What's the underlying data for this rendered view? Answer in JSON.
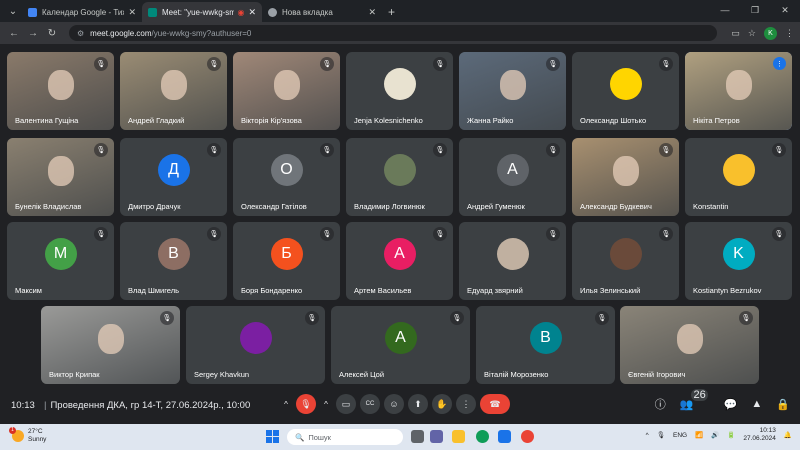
{
  "browser": {
    "tabs": [
      {
        "title": "Календар Google - Тиждень ...",
        "favicon_color": "#4285f4",
        "active": false
      },
      {
        "title": "Meet: \"yue-wwkg-smy\"",
        "favicon_color": "#00897b",
        "active": true
      },
      {
        "title": "Нова вкладка",
        "favicon_color": "#9aa0a6",
        "active": false
      }
    ],
    "url_host": "meet.google.com",
    "url_path": "/yue-wwkg-smy?authuser=0",
    "profile_initial": "K"
  },
  "participants": [
    {
      "name": "Валентина Гущіна",
      "type": "photo",
      "color": "#8a7a6a"
    },
    {
      "name": "Андрей Гладкий",
      "type": "photo",
      "color": "#9a8c74"
    },
    {
      "name": "Вікторія Кір'язова",
      "type": "photo",
      "color": "#a08878"
    },
    {
      "name": "Jenja Kolesnichenko",
      "type": "avatar",
      "initial": "",
      "color": "#e8e2d0"
    },
    {
      "name": "Жанна Райко",
      "type": "photo",
      "color": "#5c6a7a"
    },
    {
      "name": "Олександр Шотько",
      "type": "avatar",
      "initial": "",
      "color": "#ffd500"
    },
    {
      "name": "Нікіта Петров",
      "type": "photo",
      "color": "#b0a080"
    },
    {
      "name": "Бунелік Владислав",
      "type": "photo",
      "color": "#8a8070"
    },
    {
      "name": "Дмитро Драчук",
      "type": "avatar",
      "initial": "Д",
      "color": "#1a73e8"
    },
    {
      "name": "Олександр Гатілов",
      "type": "avatar",
      "initial": "О",
      "color": "#70757a"
    },
    {
      "name": "Владимир Логвинюк",
      "type": "avatar",
      "initial": "",
      "color": "#6a7a5a"
    },
    {
      "name": "Андрей Гуменюк",
      "type": "avatar",
      "initial": "А",
      "color": "#5f6368"
    },
    {
      "name": "Александр Будкевич",
      "type": "photo",
      "color": "#a89070"
    },
    {
      "name": "Konstantin",
      "type": "avatar",
      "initial": "",
      "color": "#f9c02c"
    },
    {
      "name": "Максим",
      "type": "avatar",
      "initial": "М",
      "color": "#43a047"
    },
    {
      "name": "Влад Шмигель",
      "type": "avatar",
      "initial": "В",
      "color": "#8d6e63"
    },
    {
      "name": "Боря Бондаренко",
      "type": "avatar",
      "initial": "Б",
      "color": "#f4511e"
    },
    {
      "name": "Артем Васильев",
      "type": "avatar",
      "initial": "А",
      "color": "#e91e63"
    },
    {
      "name": "Едуард звярний",
      "type": "avatar",
      "initial": "",
      "color": "#c0b0a0"
    },
    {
      "name": "Илья Зелинський",
      "type": "avatar",
      "initial": "",
      "color": "#6a4a3a"
    },
    {
      "name": "Kostiantyn Bezrukov",
      "type": "avatar",
      "initial": "K",
      "color": "#00acc1"
    },
    {
      "name": "Виктор Крипак",
      "type": "photo",
      "color": "#9a9a98"
    },
    {
      "name": "Sergey Khavkun",
      "type": "avatar",
      "initial": "",
      "color": "#7b1fa2"
    },
    {
      "name": "Алексей Цой",
      "type": "avatar",
      "initial": "А",
      "color": "#33691e"
    },
    {
      "name": "Віталій Морозенко",
      "type": "avatar",
      "initial": "В",
      "color": "#00838f"
    },
    {
      "name": "Євгеній Ігорович",
      "type": "photo",
      "color": "#8a8478"
    }
  ],
  "meeting": {
    "time": "10:13",
    "separator": "|",
    "title": "Проведення ДКА, гр 14-Т, 27.06.2024р., 10:00",
    "people_count": "26"
  },
  "taskbar": {
    "temperature": "27°C",
    "weather": "Sunny",
    "weather_badge": "1",
    "search_placeholder": "Пошук",
    "language": "ENG",
    "clock_time": "10:13",
    "clock_date": "27.06.2024"
  }
}
